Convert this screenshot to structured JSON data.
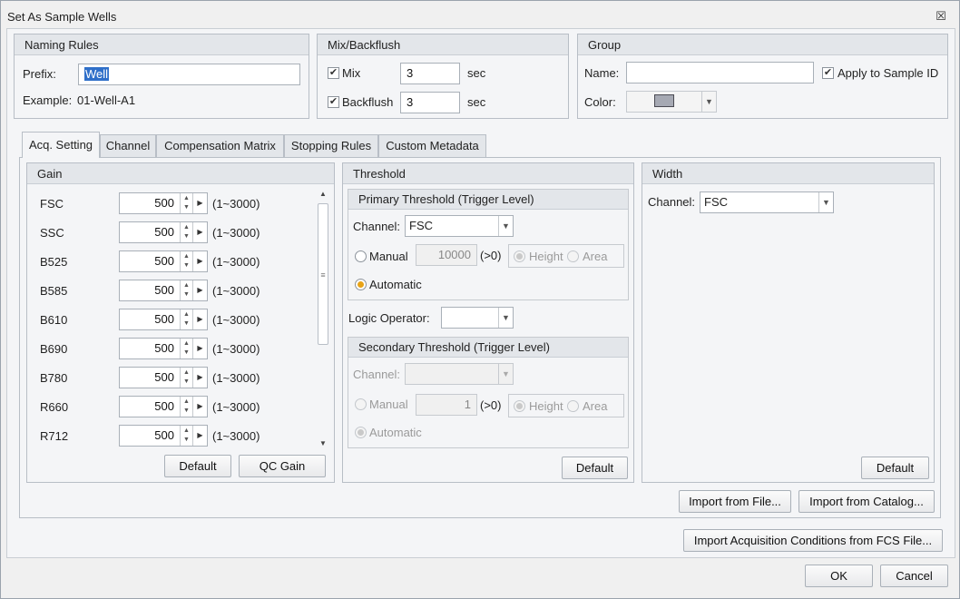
{
  "window": {
    "title": "Set As Sample Wells",
    "close_glyph": "☒"
  },
  "naming": {
    "header": "Naming Rules",
    "prefix_label": "Prefix:",
    "prefix_value": "Well",
    "example_label": "Example:",
    "example_value": "01-Well-A1"
  },
  "mix": {
    "header": "Mix/Backflush",
    "mix_label": "Mix",
    "mix_value": "3",
    "mix_unit": "sec",
    "backflush_label": "Backflush",
    "backflush_value": "3",
    "backflush_unit": "sec"
  },
  "group": {
    "header": "Group",
    "name_label": "Name:",
    "name_value": "",
    "apply_label": "Apply to Sample ID",
    "color_label": "Color:",
    "color_value": "#a6a9b3"
  },
  "tabs": [
    {
      "label": "Acq. Setting"
    },
    {
      "label": "Channel"
    },
    {
      "label": "Compensation Matrix"
    },
    {
      "label": "Stopping Rules"
    },
    {
      "label": "Custom Metadata"
    }
  ],
  "gain": {
    "header": "Gain",
    "rows": [
      {
        "channel": "FSC",
        "value": "500",
        "range": "(1~3000)"
      },
      {
        "channel": "SSC",
        "value": "500",
        "range": "(1~3000)"
      },
      {
        "channel": "B525",
        "value": "500",
        "range": "(1~3000)"
      },
      {
        "channel": "B585",
        "value": "500",
        "range": "(1~3000)"
      },
      {
        "channel": "B610",
        "value": "500",
        "range": "(1~3000)"
      },
      {
        "channel": "B690",
        "value": "500",
        "range": "(1~3000)"
      },
      {
        "channel": "B780",
        "value": "500",
        "range": "(1~3000)"
      },
      {
        "channel": "R660",
        "value": "500",
        "range": "(1~3000)"
      },
      {
        "channel": "R712",
        "value": "500",
        "range": "(1~3000)"
      }
    ],
    "default_button": "Default",
    "qc_button": "QC Gain"
  },
  "threshold": {
    "header": "Threshold",
    "primary": {
      "header": "Primary Threshold (Trigger Level)",
      "channel_label": "Channel:",
      "channel_value": "FSC",
      "manual_label": "Manual",
      "manual_value": "10000",
      "manual_hint": "(>0)",
      "height_label": "Height",
      "area_label": "Area",
      "automatic_label": "Automatic"
    },
    "logic_label": "Logic Operator:",
    "logic_value": "",
    "secondary": {
      "header": "Secondary Threshold (Trigger Level)",
      "channel_label": "Channel:",
      "channel_value": "",
      "manual_label": "Manual",
      "manual_value": "1",
      "manual_hint": "(>0)",
      "height_label": "Height",
      "area_label": "Area",
      "automatic_label": "Automatic"
    },
    "default_button": "Default"
  },
  "width": {
    "header": "Width",
    "channel_label": "Channel:",
    "channel_value": "FSC",
    "default_button": "Default"
  },
  "import": {
    "from_file": "Import from File...",
    "from_catalog": "Import from Catalog...",
    "from_fcs": "Import Acquisition Conditions from FCS File..."
  },
  "footer": {
    "ok": "OK",
    "cancel": "Cancel"
  }
}
